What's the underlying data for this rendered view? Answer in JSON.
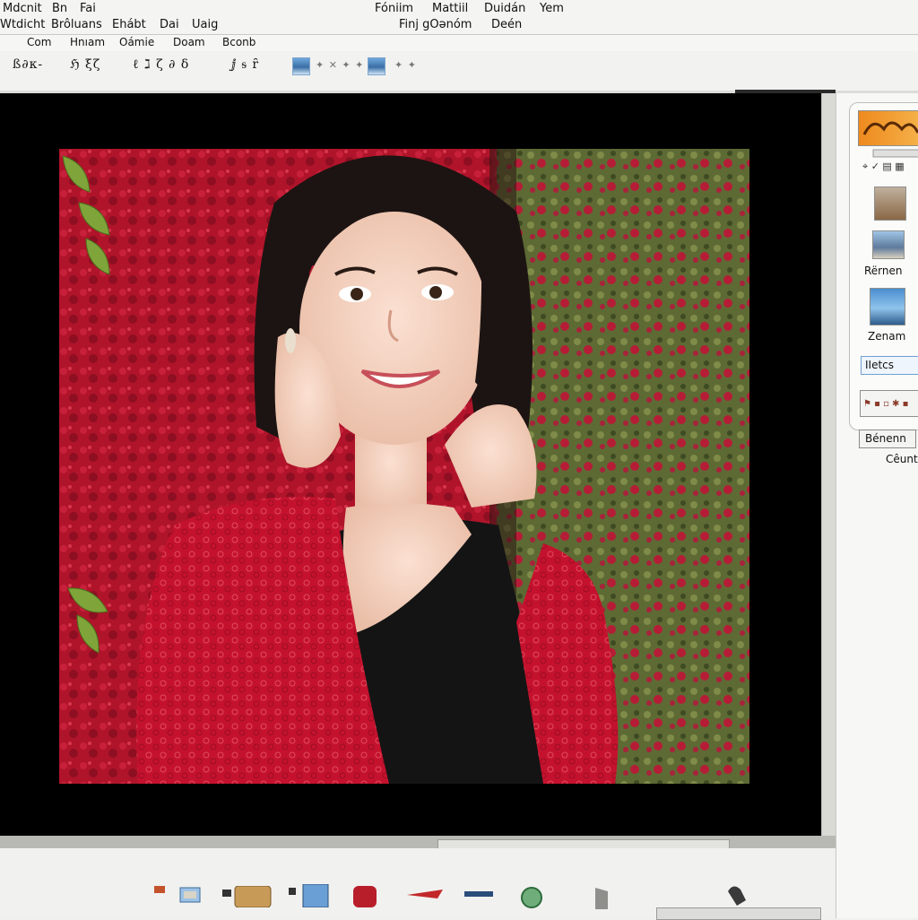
{
  "menu": {
    "row1": [
      "Mdcnit",
      "Bn",
      "Fai"
    ],
    "row1_right": [
      "Fóniim",
      "Mattiil",
      "Duidán",
      "Yem"
    ],
    "row2": [
      "Wtdicht",
      "Brôluans",
      "Ehábt",
      "Dai",
      "Uaig"
    ],
    "row2_right": [
      "Finj gOənóm",
      "Deén"
    ]
  },
  "subbar": [
    "Com",
    "Hnıam",
    "Oámie",
    "Doam",
    "Bconb"
  ],
  "toolbar": {
    "glyphs": [
      "ß∂κ-",
      "ℌ ξζ",
      "ℓ ℷ ζ ∂ δ",
      "ⅉ ᵴ ȓ"
    ]
  },
  "side_panel": {
    "labels": [
      "Rërnen",
      "Zenam"
    ],
    "field": "IIetcs",
    "button": "Bénenn",
    "caption": "Cêuntı"
  },
  "icons": {
    "toolbar": [
      "edit-icon",
      "brush-icon",
      "text-icon",
      "crop-icon",
      "image-icon",
      "star-icon"
    ],
    "dock": [
      "camera-icon",
      "folder-icon",
      "screen-icon",
      "jar-icon",
      "brush-icon",
      "pen-icon",
      "globe-icon",
      "bookmark-icon",
      "mouse-icon"
    ]
  },
  "colors": {
    "canvas": "#000000",
    "accent": "#6f9fd2",
    "panel_bg": "#f7f7f5"
  }
}
